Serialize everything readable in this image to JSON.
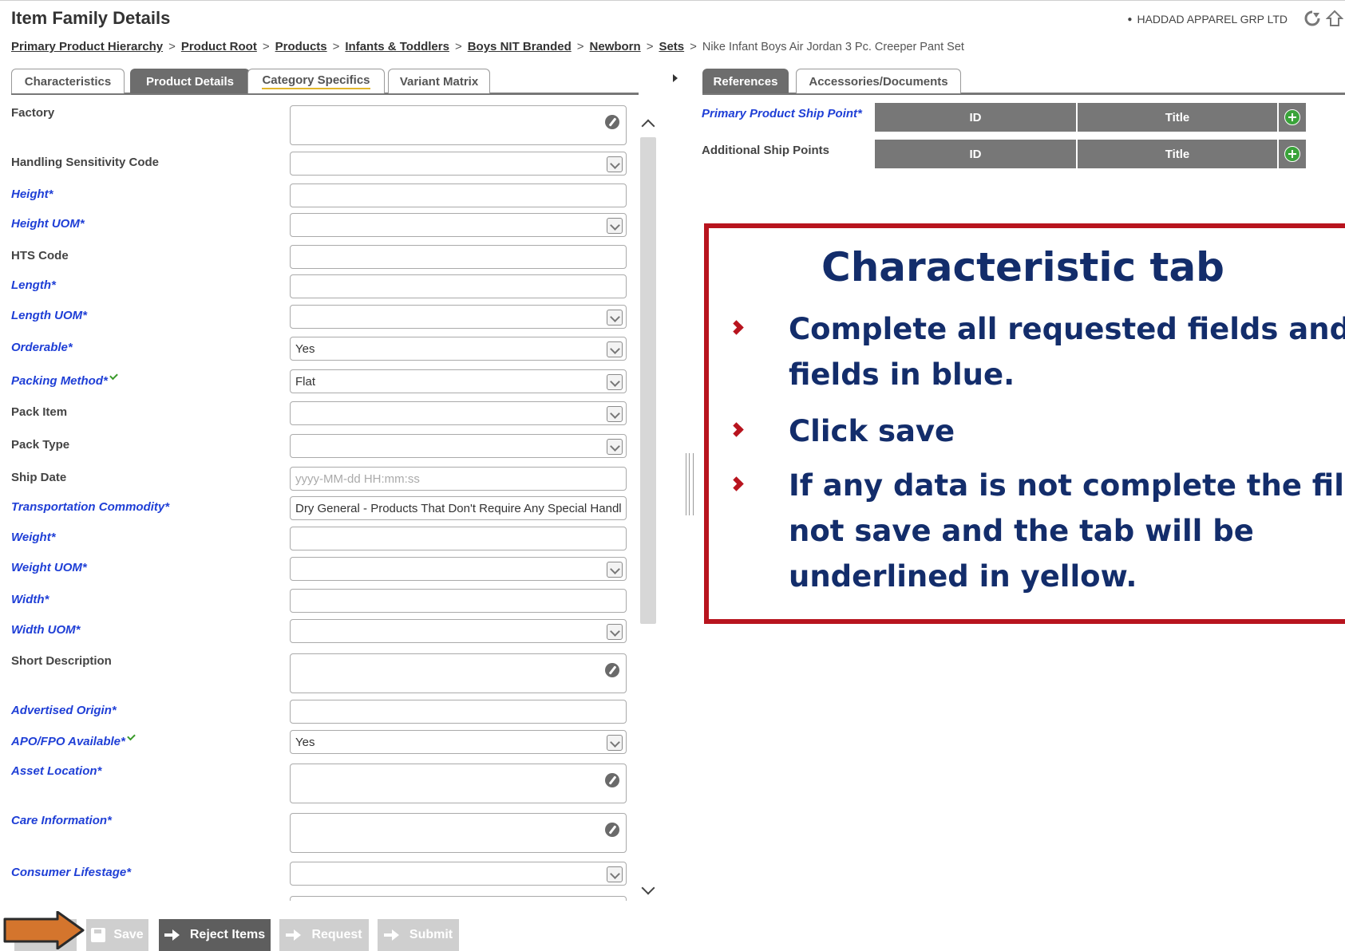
{
  "header": {
    "title": "Item Family Details",
    "company": "HADDAD APPAREL GRP LTD",
    "icons": [
      "refresh-icon",
      "home-icon"
    ]
  },
  "breadcrumb": {
    "sep": ">",
    "items": [
      "Primary Product Hierarchy",
      "Product Root",
      "Products",
      "Infants & Toddlers",
      "Boys NIT Branded",
      "Newborn",
      "Sets"
    ],
    "current": "Nike Infant Boys Air Jordan 3 Pc. Creeper Pant Set"
  },
  "left_tabs": [
    {
      "label": "Characteristics",
      "active": false
    },
    {
      "label": "Product Details",
      "active": true
    },
    {
      "label": "Category Specifics",
      "active": false,
      "flag": "yellow-underline"
    },
    {
      "label": "Variant Matrix",
      "active": false
    }
  ],
  "right_tabs": [
    {
      "label": "References",
      "active": true
    },
    {
      "label": "Accessories/Documents",
      "active": false
    }
  ],
  "fields": [
    {
      "label": "Factory",
      "required": false,
      "type": "textarea",
      "value": ""
    },
    {
      "label": "Handling Sensitivity Code",
      "required": false,
      "type": "select",
      "value": ""
    },
    {
      "label": "Height*",
      "required": true,
      "type": "text",
      "value": ""
    },
    {
      "label": "Height UOM*",
      "required": true,
      "type": "select",
      "value": ""
    },
    {
      "label": "HTS Code",
      "required": false,
      "type": "text",
      "value": ""
    },
    {
      "label": "Length*",
      "required": true,
      "type": "text",
      "value": ""
    },
    {
      "label": "Length UOM*",
      "required": true,
      "type": "select",
      "value": ""
    },
    {
      "label": "Orderable*",
      "required": true,
      "type": "select",
      "value": "Yes"
    },
    {
      "label": "Packing Method*",
      "required": true,
      "type": "select",
      "value": "Flat",
      "check": true
    },
    {
      "label": "Pack Item",
      "required": false,
      "type": "select",
      "value": ""
    },
    {
      "label": "Pack Type",
      "required": false,
      "type": "select",
      "value": ""
    },
    {
      "label": "Ship Date",
      "required": false,
      "type": "text",
      "value": "",
      "placeholder": "yyyy-MM-dd HH:mm:ss"
    },
    {
      "label": "Transportation Commodity*",
      "required": true,
      "type": "text",
      "value": "Dry General - Products That Don't Require Any Special Handl"
    },
    {
      "label": "Weight*",
      "required": true,
      "type": "text",
      "value": ""
    },
    {
      "label": "Weight UOM*",
      "required": true,
      "type": "select",
      "value": ""
    },
    {
      "label": "Width*",
      "required": true,
      "type": "text",
      "value": ""
    },
    {
      "label": "Width UOM*",
      "required": true,
      "type": "select",
      "value": ""
    },
    {
      "label": "Short Description",
      "required": false,
      "type": "textarea",
      "value": ""
    },
    {
      "label": "Advertised Origin*",
      "required": true,
      "type": "text",
      "value": ""
    },
    {
      "label": "APO/FPO Available*",
      "required": true,
      "type": "select",
      "value": "Yes",
      "check": true
    },
    {
      "label": "Asset Location*",
      "required": true,
      "type": "textarea",
      "value": ""
    },
    {
      "label": "Care Information*",
      "required": true,
      "type": "textarea",
      "value": ""
    },
    {
      "label": "Consumer Lifestage*",
      "required": true,
      "type": "select",
      "value": ""
    }
  ],
  "references": {
    "rows": [
      {
        "label": "Primary Product Ship Point*",
        "required": true,
        "col_id": "ID",
        "col_title": "Title"
      },
      {
        "label": "Additional Ship Points",
        "required": false,
        "col_id": "ID",
        "col_title": "Title"
      }
    ]
  },
  "callout": {
    "title": "Characteristic tab",
    "bullets": [
      [
        "Complete all requested fields and ar",
        "fields in blue."
      ],
      [
        "Click save"
      ],
      [
        "If any data is not complete the file w",
        "not save and the tab will be",
        "underlined in yellow."
      ]
    ],
    "colors": {
      "border": "#b8141e",
      "text": "#132d6b"
    }
  },
  "footer": {
    "buttons": [
      {
        "label": "Save",
        "enabled": false
      },
      {
        "label": "Reject Items",
        "enabled": true
      },
      {
        "label": "Request",
        "enabled": false
      },
      {
        "label": "Submit",
        "enabled": false
      }
    ],
    "pointer_color": "#d4752d"
  }
}
